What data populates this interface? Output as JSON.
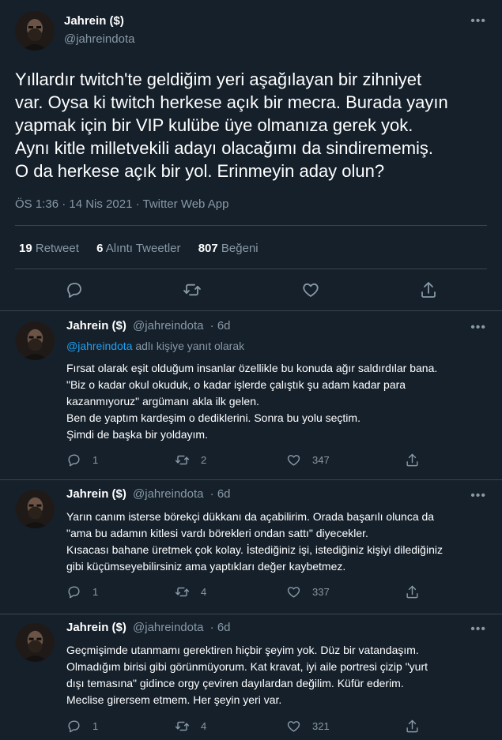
{
  "main_tweet": {
    "name": "Jahrein ($)",
    "handle": "@jahreindota",
    "text_lines": [
      "Yıllardır twitch'te geldiğim yeri aşağılayan bir zihniyet",
      "var. Oysa ki twitch herkese açık bir mecra. Burada yayın",
      "yapmak için bir VIP kulübe üye olmanıza gerek yok.",
      "Aynı kitle milletvekili adayı olacağımı da sindirememiş.",
      "O da herkese açık bir yol. Erinmeyin aday olun?"
    ],
    "meta": "ÖS 1:36 · 14 Nis 2021 · Twitter Web App",
    "stats": {
      "retweets_count": "19",
      "retweets_label": "Retweet",
      "quotes_count": "6",
      "quotes_label": "Alıntı Tweetler",
      "likes_count": "807",
      "likes_label": "Beğeni"
    },
    "icons": [
      "reply-icon",
      "retweet-icon",
      "like-icon",
      "share-icon"
    ]
  },
  "replies": [
    {
      "name": "Jahrein ($)",
      "handle": "@jahreindota",
      "time": "· 6d",
      "reply_to": {
        "link": "@jahreindota",
        "suffix": " adlı kişiye yanıt olarak"
      },
      "lines": [
        "Fırsat olarak eşit olduğum insanlar özellikle bu konuda ağır saldırdılar bana.",
        "\"Biz o kadar okul okuduk, o kadar işlerde çalıştık şu adam kadar para",
        "kazanmıyoruz\" argümanı akla ilk gelen.",
        "Ben de yaptım kardeşim o dediklerini. Sonra bu yolu seçtim.",
        "Şimdi de başka bir yoldayım."
      ],
      "replies_count": "1",
      "retweets_count": "2",
      "likes_count": "347"
    },
    {
      "name": "Jahrein ($)",
      "handle": "@jahreindota",
      "time": "· 6d",
      "lines": [
        "Yarın canım isterse börekçi dükkanı da açabilirim. Orada başarılı olunca da",
        "\"ama bu adamın kitlesi vardı börekleri ondan sattı\" diyecekler.",
        "Kısacası bahane üretmek çok kolay. İstediğiniz işi, istediğiniz kişiyi dilediğiniz",
        "gibi küçümseyebilirsiniz ama yaptıkları değer kaybetmez."
      ],
      "replies_count": "1",
      "retweets_count": "4",
      "likes_count": "337"
    },
    {
      "name": "Jahrein ($)",
      "handle": "@jahreindota",
      "time": "· 6d",
      "lines": [
        "Geçmişimde utanmamı gerektiren hiçbir şeyim yok. Düz bir vatandaşım.",
        "Olmadığım birisi gibi görünmüyorum. Kat kravat, iyi aile portresi çizip \"yurt",
        "dışı temasına\" gidince orgy çeviren dayılardan değilim. Küfür ederim.",
        "Meclise girersem etmem. Her şeyin yeri var."
      ],
      "replies_count": "1",
      "retweets_count": "4",
      "likes_count": "321"
    }
  ],
  "colors": {
    "background": "#15202b",
    "text": "#ffffff",
    "secondary": "#8899a6",
    "accent": "#1da1f2",
    "divider": "#38444d"
  }
}
